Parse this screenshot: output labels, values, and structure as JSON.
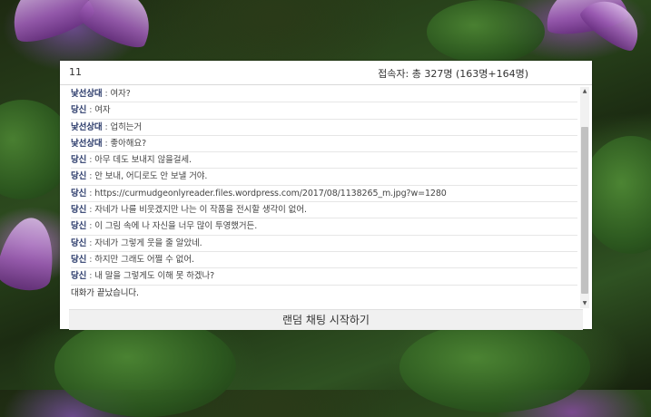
{
  "header": {
    "room_id": "11",
    "visitors": "접속자: 총 327명 (163명+164명)"
  },
  "messages": [
    {
      "speaker": "낯선상대",
      "separator": " : ",
      "text": "여자?"
    },
    {
      "speaker": "당신",
      "separator": " : ",
      "text": "여자"
    },
    {
      "speaker": "낯선상대",
      "separator": " : ",
      "text": "업히는거"
    },
    {
      "speaker": "낯선상대",
      "separator": " : ",
      "text": "좋아해요?"
    },
    {
      "speaker": "당신",
      "separator": " : ",
      "text": "아무 데도 보내지 않을걸세."
    },
    {
      "speaker": "당신",
      "separator": " : ",
      "text": "안 보내, 어디로도 안 보낼 거야."
    },
    {
      "speaker": "당신",
      "separator": " : ",
      "text": "https://curmudgeonlyreader.files.wordpress.com/2017/08/1138265_m.jpg?w=1280"
    },
    {
      "speaker": "당신",
      "separator": " : ",
      "text": "자네가 나를 비웃겠지만 나는 이 작품을 전시할 생각이 없어."
    },
    {
      "speaker": "당신",
      "separator": " : ",
      "text": "이 그림 속에 나 자신을 너무 많이 투영했거든."
    },
    {
      "speaker": "당신",
      "separator": " : ",
      "text": "자네가 그렇게 웃을 줄 알았네."
    },
    {
      "speaker": "당신",
      "separator": " : ",
      "text": "하지만 그래도 어쩔 수 없어."
    },
    {
      "speaker": "당신",
      "separator": " : ",
      "text": "내 말을 그렇게도 이해 못 하겠나?"
    }
  ],
  "system_message": "대화가 끝났습니다.",
  "scrollbar": {
    "up_arrow": "▲",
    "down_arrow": "▼"
  },
  "start_button": {
    "label": "랜덤 채팅 시작하기"
  },
  "colors": {
    "speaker": "#2a3a6a",
    "panel_bg": "#ffffff",
    "button_bg": "#f0f0f0"
  }
}
